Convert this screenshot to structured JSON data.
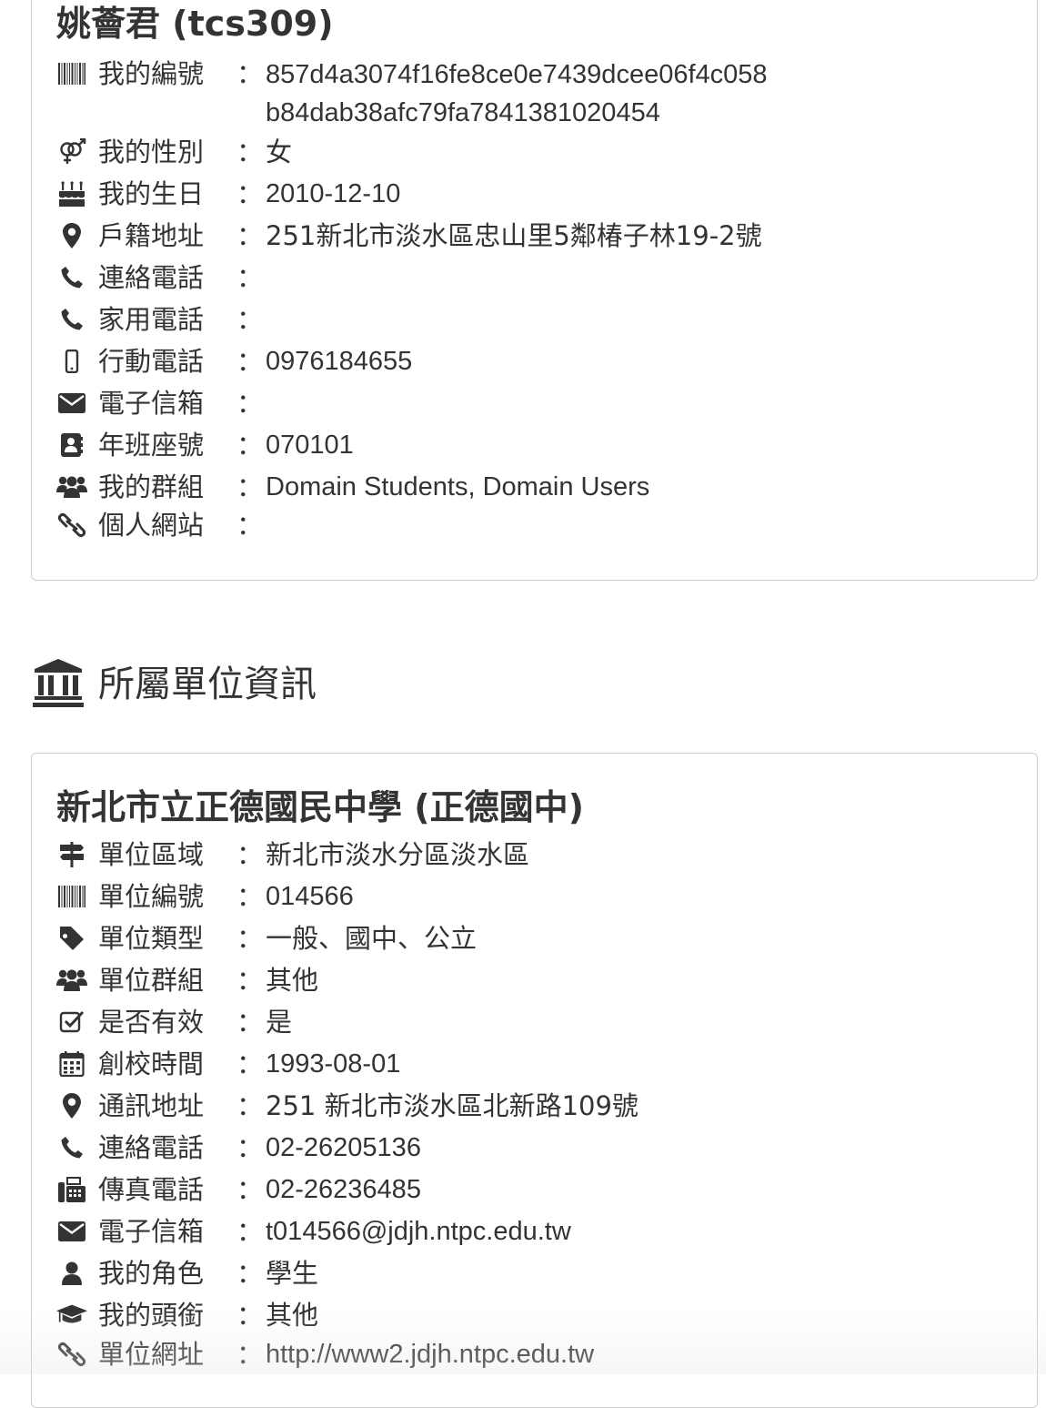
{
  "user_card": {
    "title": "姚薈君 (tcs309)",
    "rows": {
      "id_number": {
        "label": "我的編號",
        "value": "857d4a3074f16fe8ce0e7439dcee06f4c058b84dab38afc79fa7841381020454",
        "icon": "barcode-icon"
      },
      "gender": {
        "label": "我的性別",
        "value": "女",
        "icon": "gender-icon"
      },
      "birthday": {
        "label": "我的生日",
        "value": "2010-12-10",
        "icon": "birthday-cake-icon"
      },
      "household_address": {
        "label": "戶籍地址",
        "value": "251新北市淡水區忠山里5鄰椿子林19-2號",
        "icon": "map-marker-icon"
      },
      "contact_phone": {
        "label": "連絡電話",
        "value": "",
        "icon": "phone-icon"
      },
      "home_phone": {
        "label": "家用電話",
        "value": "",
        "icon": "phone-icon"
      },
      "mobile_phone": {
        "label": "行動電話",
        "value": "0976184655",
        "icon": "mobile-icon"
      },
      "email": {
        "label": "電子信箱",
        "value": "",
        "icon": "envelope-icon"
      },
      "class_seat": {
        "label": "年班座號",
        "value": "070101",
        "icon": "address-book-icon"
      },
      "groups": {
        "label": "我的群組",
        "value": "Domain Students, Domain Users",
        "icon": "users-icon"
      },
      "website": {
        "label": "個人網站",
        "value": "",
        "icon": "link-icon"
      }
    }
  },
  "unit_section": {
    "heading": "所屬單位資訊",
    "icon": "institution-icon"
  },
  "unit_card": {
    "title": "新北市立正德國民中學 (正德國中)",
    "rows": {
      "region": {
        "label": "單位區域",
        "value": "新北市淡水分區淡水區",
        "icon": "signpost-icon"
      },
      "unit_number": {
        "label": "單位編號",
        "value": "014566",
        "icon": "barcode-icon"
      },
      "unit_type": {
        "label": "單位類型",
        "value": "一般、國中、公立",
        "icon": "tag-icon"
      },
      "unit_group": {
        "label": "單位群組",
        "value": "其他",
        "icon": "users-icon"
      },
      "is_valid": {
        "label": "是否有效",
        "value": "是",
        "icon": "check-square-icon"
      },
      "founded": {
        "label": "創校時間",
        "value": "1993-08-01",
        "icon": "calendar-icon"
      },
      "mailing_address": {
        "label": "通訊地址",
        "value": "251 新北市淡水區北新路109號",
        "icon": "map-marker-icon"
      },
      "contact_phone": {
        "label": "連絡電話",
        "value": "02-26205136",
        "icon": "phone-icon"
      },
      "fax": {
        "label": "傳真電話",
        "value": "02-26236485",
        "icon": "fax-icon"
      },
      "email": {
        "label": "電子信箱",
        "value": "t014566@jdjh.ntpc.edu.tw",
        "icon": "envelope-icon"
      },
      "my_role": {
        "label": "我的角色",
        "value": "學生",
        "icon": "user-icon"
      },
      "my_title": {
        "label": "我的頭銜",
        "value": "其他",
        "icon": "graduation-cap-icon"
      },
      "unit_website": {
        "label": "單位網址",
        "value": "http://www2.jdjh.ntpc.edu.tw",
        "icon": "link-icon"
      }
    }
  },
  "colon": "："
}
